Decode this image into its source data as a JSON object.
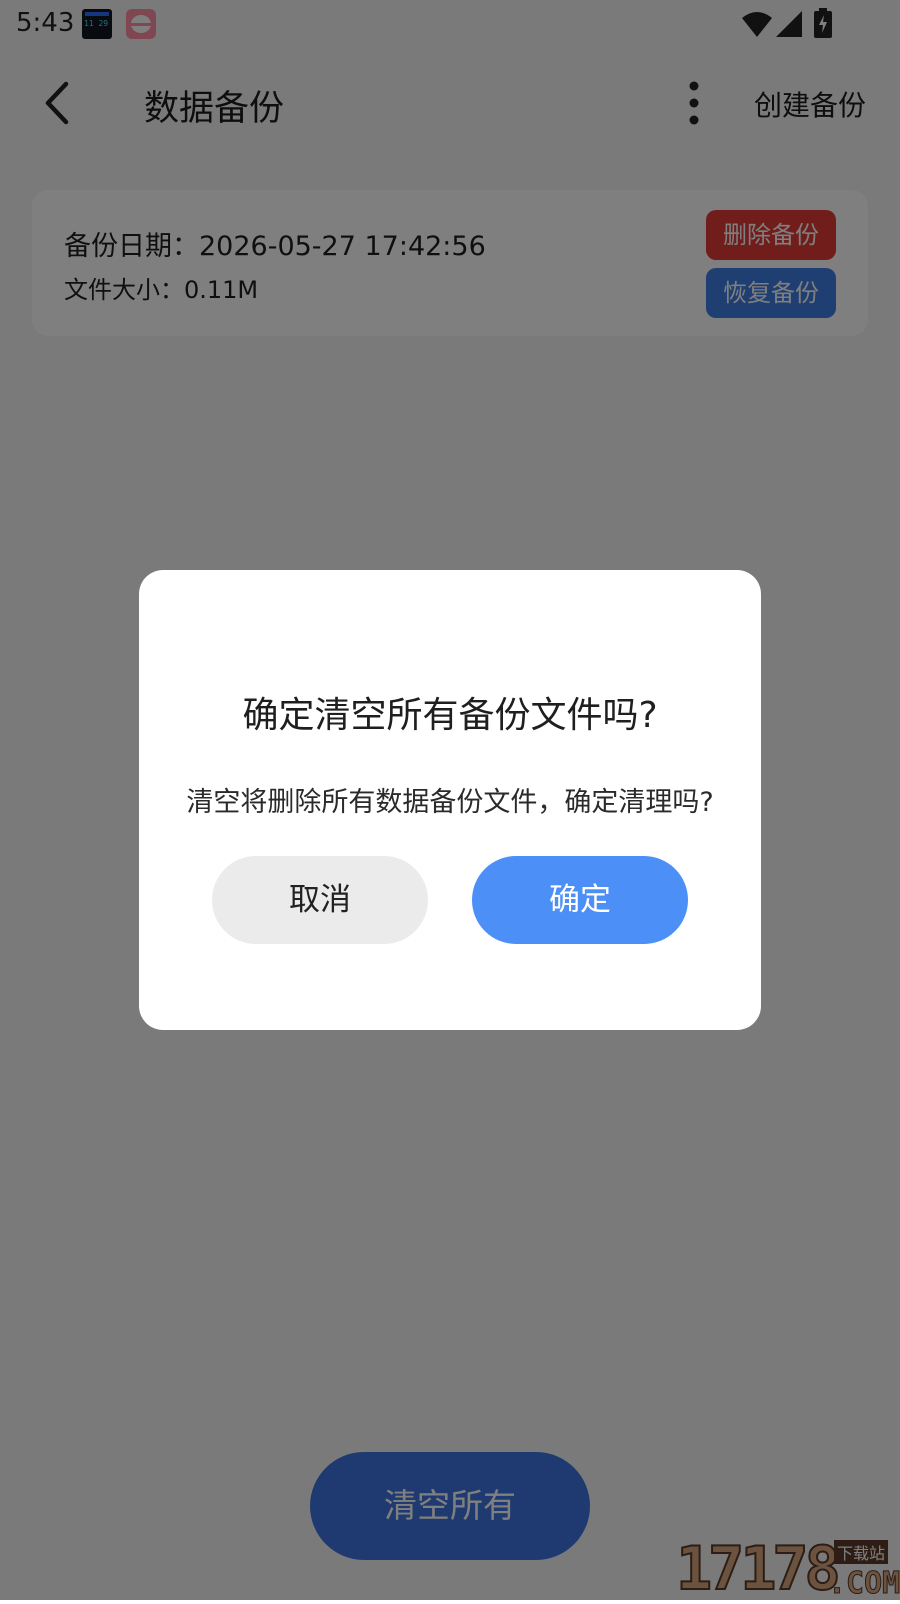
{
  "status_bar": {
    "time": "5:43"
  },
  "app_bar": {
    "title": "数据备份",
    "create_backup_label": "创建备份"
  },
  "backup_item": {
    "date_text": "备份日期：2026-05-27 17:42:56",
    "size_text": "文件大小：0.11M",
    "delete_label": "删除备份",
    "restore_label": "恢复备份"
  },
  "footer": {
    "clear_all_label": "清空所有"
  },
  "dialog": {
    "title": "确定清空所有备份文件吗?",
    "message": "清空将删除所有数据备份文件，确定清理吗?",
    "cancel_label": "取消",
    "confirm_label": "确定"
  },
  "watermark": {
    "digits": "17178",
    "site_label": "下载站",
    "com_label": ".COM"
  },
  "colors": {
    "delete_button": "#e33b38",
    "restore_button": "#3f7de5",
    "clear_all_button": "#3f74e0",
    "confirm_button": "#4b8ff7",
    "cancel_button": "#ebebeb",
    "scrim": "rgba(0,0,0,0.5)"
  },
  "icons": {
    "back": "back-arrow-icon",
    "more": "more-vertical-icon",
    "wifi": "wifi-icon",
    "cell": "cell-signal-icon",
    "battery": "battery-charging-icon"
  }
}
